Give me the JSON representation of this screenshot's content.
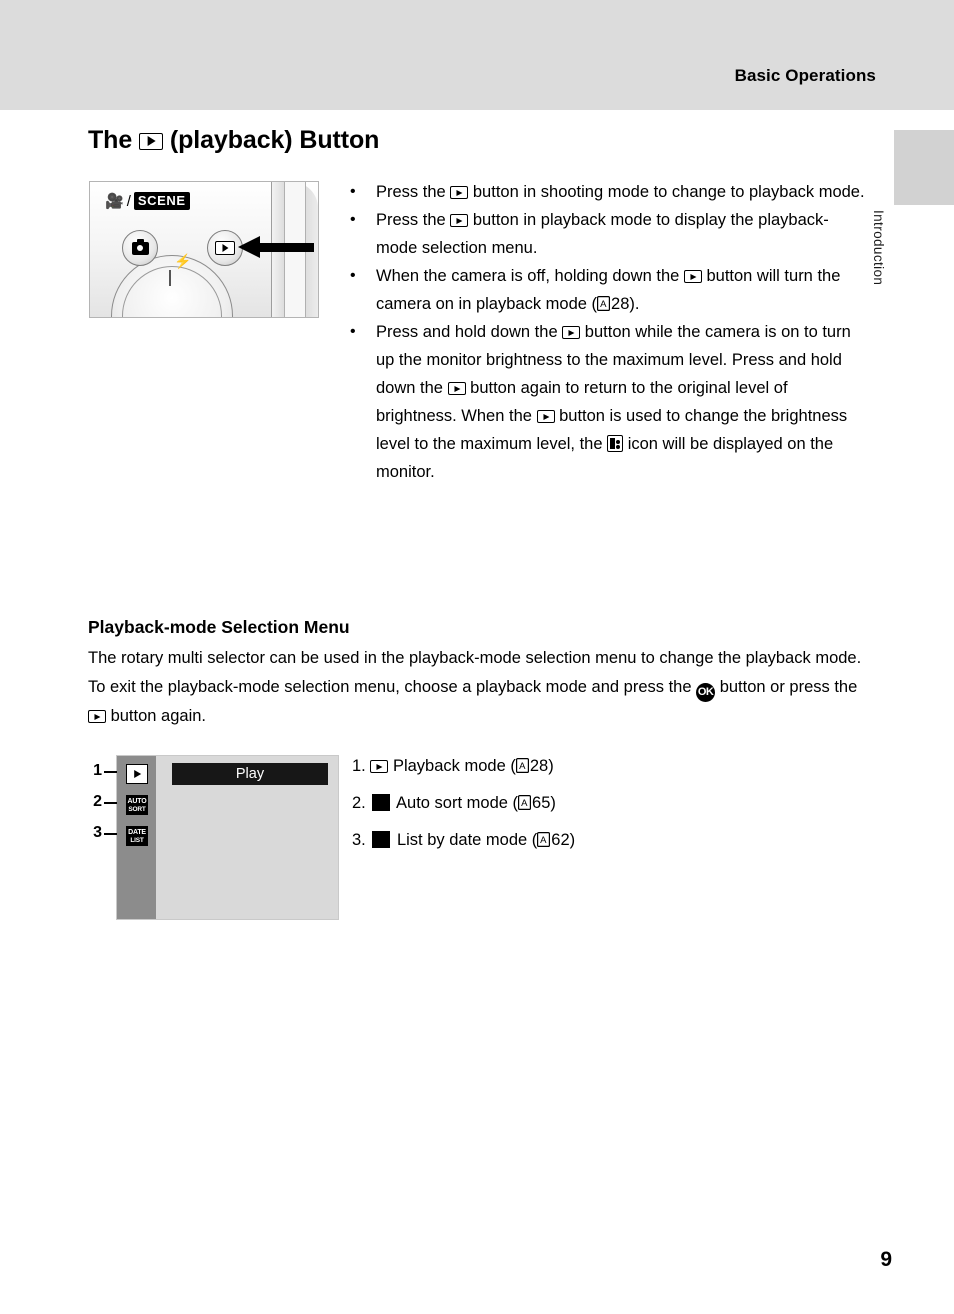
{
  "header": {
    "running_head": "Basic Operations",
    "side_tab_label": "Introduction"
  },
  "title": {
    "before_icon": "The",
    "icon": "playback-icon",
    "after_icon": "(playback) Button"
  },
  "camera_figure": {
    "mode_label_movie": "☠",
    "mode_label_slash": "/",
    "mode_label_scene": "SCENE",
    "camera_button": "shooting-mode-button",
    "playback_button": "playback-button",
    "flash_glyph": "⚡",
    "arrow": "pointer-arrow"
  },
  "bullets": [
    {
      "marker": "•",
      "parts": [
        {
          "t": "text",
          "v": "Press the "
        },
        {
          "t": "play",
          "v": ""
        },
        {
          "t": "text",
          "v": " button in shooting mode to change to playback mode."
        }
      ]
    },
    {
      "marker": "•",
      "parts": [
        {
          "t": "text",
          "v": "Press the "
        },
        {
          "t": "play",
          "v": ""
        },
        {
          "t": "text",
          "v": " button in playback mode to display the playback-mode selection menu."
        }
      ]
    },
    {
      "marker": "•",
      "parts": [
        {
          "t": "text",
          "v": "When the camera is off, holding down the "
        },
        {
          "t": "play",
          "v": ""
        },
        {
          "t": "text",
          "v": " button will turn the camera on in playback mode ("
        },
        {
          "t": "aref",
          "v": "28"
        },
        {
          "t": "text",
          "v": ")."
        }
      ]
    },
    {
      "marker": "•",
      "parts": [
        {
          "t": "text",
          "v": "Press and hold down the "
        },
        {
          "t": "play",
          "v": ""
        },
        {
          "t": "text",
          "v": " button while the camera is on to turn up the monitor brightness to the maximum level. Press and hold down the "
        },
        {
          "t": "play",
          "v": ""
        },
        {
          "t": "text",
          "v": " button again to return to the original level of brightness. When the "
        },
        {
          "t": "play",
          "v": ""
        },
        {
          "t": "text",
          "v": " button is used to change the brightness level to the maximum level, the "
        },
        {
          "t": "bright",
          "v": ""
        },
        {
          "t": "text",
          "v": " icon will be displayed on the monitor."
        }
      ]
    }
  ],
  "section2": {
    "heading": "Playback-mode Selection Menu",
    "paragraph_parts": [
      {
        "t": "text",
        "v": "The rotary multi selector can be used in the playback-mode selection menu to change the playback mode. To exit the playback-mode selection menu, choose a playback mode and press the "
      },
      {
        "t": "ok",
        "v": "OK"
      },
      {
        "t": "text",
        "v": " button or press the "
      },
      {
        "t": "play",
        "v": ""
      },
      {
        "t": "text",
        "v": " button again."
      }
    ]
  },
  "menu_figure": {
    "callout_numbers": [
      "1",
      "2",
      "3"
    ],
    "selected_label": "Play",
    "items": [
      {
        "icon": "playback-icon",
        "label": ""
      },
      {
        "icon": "auto-sort-icon",
        "top": "AUTO",
        "bottom": "SORT"
      },
      {
        "icon": "list-by-date-icon",
        "top": "DATE",
        "bottom": "LIST"
      }
    ]
  },
  "mode_list": [
    {
      "number": "1.",
      "icon": "playback-icon",
      "label": "Playback mode",
      "ref_open": "(",
      "ref": "28",
      "ref_close": ")"
    },
    {
      "number": "2.",
      "icon": "auto-sort-icon",
      "label": "Auto sort mode",
      "ref_open": "(",
      "ref": "65",
      "ref_close": ")"
    },
    {
      "number": "3.",
      "icon": "list-by-date-icon",
      "label": "List by date mode",
      "ref_open": "(",
      "ref": "62",
      "ref_close": ")"
    }
  ],
  "footer": {
    "page_number": "9"
  }
}
